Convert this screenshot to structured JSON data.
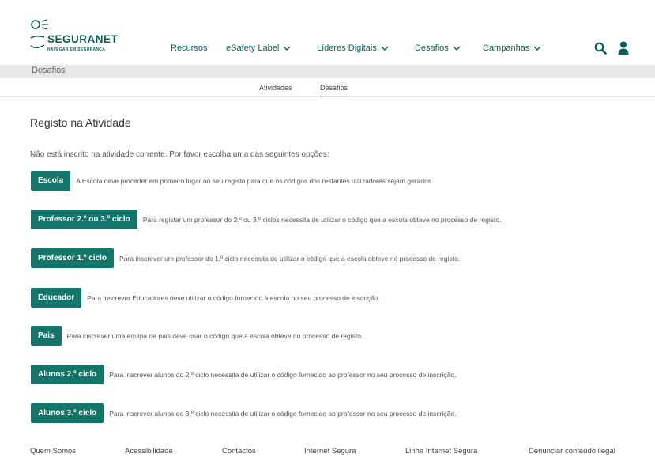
{
  "header": {
    "logo_title": "SEGURANET",
    "logo_subtitle": "NAVEGAR EM SEGURANÇA",
    "nav": [
      {
        "label": "Recursos"
      },
      {
        "label": "eSafety Label"
      },
      {
        "label": "Líderes Digitais"
      },
      {
        "label": "Desafios"
      },
      {
        "label": "Campanhas"
      }
    ],
    "icons": [
      "search-icon",
      "user-icon"
    ]
  },
  "breadcrumb": "Desafios",
  "subtabs": [
    {
      "label": "Atividades",
      "active": false
    },
    {
      "label": "Desafios",
      "active": true
    }
  ],
  "main": {
    "title": "Registo na Atividade",
    "intro": "Não está inscrito na atividade corrente. Por favor escolha uma das seguintes opções:",
    "options": [
      {
        "button": "Escola",
        "description": "A Escola deve proceder em primeiro lugar ao seu registo para que os códigos dos restantes utilizadores sejam gerados."
      },
      {
        "button": "Professor 2.º ou 3.º ciclo",
        "description": "Para registar um professor do 2.º ou 3.º ciclos necessita de utilizar o código que a escola obteve no processo de registo."
      },
      {
        "button": "Professor 1.º ciclo",
        "description": "Para inscrever um professor do 1.º ciclo necessita de utilizar o código que a escola obteve no processo de registo."
      },
      {
        "button": "Educador",
        "description": "Para inscrever Educadores deve utilizar o código fornecido à escola no seu processo de inscrição."
      },
      {
        "button": "Pais",
        "description": "Para inscrever uma equipa de pais deve usar o código que a escola obteve no processo de registo."
      },
      {
        "button": "Alunos 2.º ciclo",
        "description": "Para inscrever alunos do 2.º ciclo necessita de utilizar o código fornecido ao professor no seu processo de inscrição."
      },
      {
        "button": "Alunos 3.º ciclo",
        "description": "Para inscrever alunos do 3.º ciclo necessita de utilizar o código fornecido ao professor no seu processo de inscrição."
      }
    ]
  },
  "footer": {
    "links": [
      "Quem Somos",
      "Acessibilidade",
      "Contactos",
      "Internet Segura",
      "Linha Internet Segura",
      "Denunciar conteúdo ilegal"
    ]
  },
  "colors": {
    "brand": "#0b5f57",
    "button": "#14756a"
  }
}
